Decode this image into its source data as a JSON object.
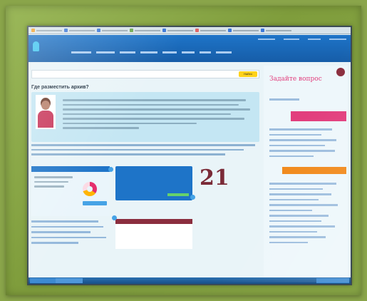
{
  "browser": {
    "bookmarks": [
      {
        "color": "#f2a12a"
      },
      {
        "color": "#3c78d8"
      },
      {
        "color": "#3c78d8"
      },
      {
        "color": "#6aa84f"
      },
      {
        "color": "#3c78d8"
      },
      {
        "color": "#e06666"
      },
      {
        "color": "#3c78d8"
      },
      {
        "color": "#3c78d8"
      }
    ]
  },
  "site": {
    "accent": "#1e74c8",
    "pink": "#e23e7d",
    "orange": "#f18a1c",
    "maroon": "#8b2e3e"
  },
  "main": {
    "search_button": "Найти",
    "article_title": "Где разместить архив?"
  },
  "stats": {
    "big_number": "21"
  },
  "right": {
    "title": "Задайте вопрос"
  }
}
